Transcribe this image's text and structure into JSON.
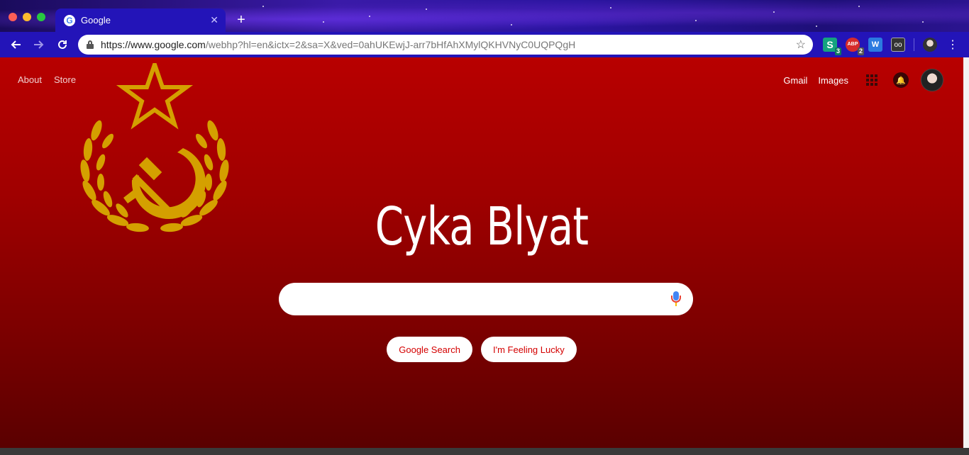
{
  "tab": {
    "title": "Google",
    "favicon_icon": "google-g-icon"
  },
  "omnibox": {
    "url_host": "https://www.google.com",
    "url_path": "/webhp?hl=en&ictx=2&sa=X&ved=0ahUKEwjJ-arr7bHfAhXMylQKHVNyC0UQPQgH"
  },
  "extensions": [
    {
      "name": "s-extension-icon",
      "label": "S",
      "badge": "3"
    },
    {
      "name": "adblock-plus-icon",
      "label": "ABP",
      "badge": "2"
    },
    {
      "name": "w-extension-icon",
      "label": "W",
      "badge": ""
    },
    {
      "name": "oo-extension-icon",
      "label": "oo",
      "badge": ""
    }
  ],
  "header": {
    "left_links": [
      "About",
      "Store"
    ],
    "right_links": [
      "Gmail",
      "Images"
    ]
  },
  "logo_text": "Cyka Blyat",
  "search": {
    "placeholder": ""
  },
  "buttons": {
    "search": "Google Search",
    "lucky": "I'm Feeling Lucky"
  },
  "colors": {
    "page_top": "#b80000",
    "page_bottom": "#5a0000",
    "emblem_gold": "#d4a000",
    "chrome_blue": "#2314b8"
  }
}
